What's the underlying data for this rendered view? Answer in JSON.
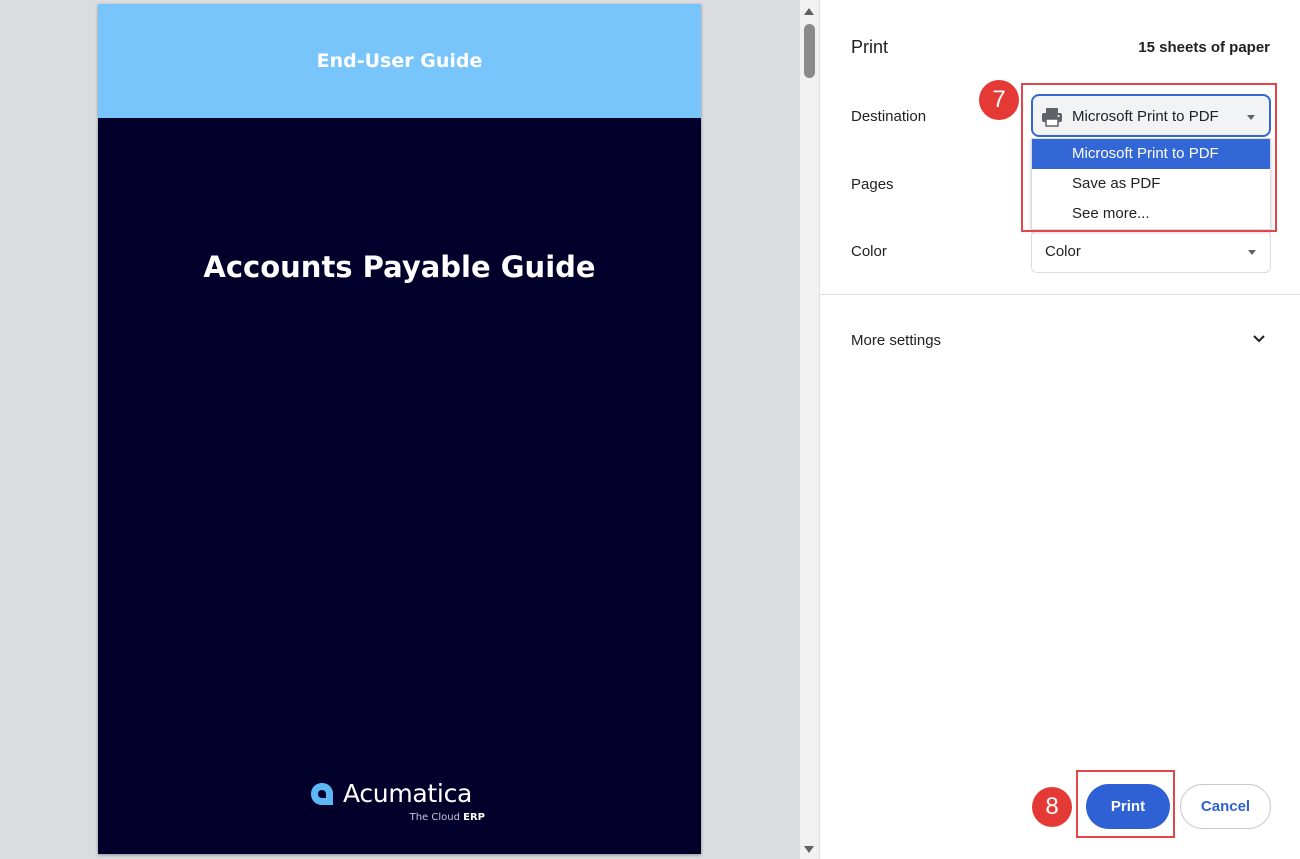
{
  "preview": {
    "header_text": "End-User Guide",
    "doc_title": "Accounts Payable Guide",
    "logo": {
      "name": "Acumatica",
      "tagline_prefix": "The Cloud",
      "tagline_bold": "ERP"
    }
  },
  "panel": {
    "title": "Print",
    "sheets": "15 sheets of paper",
    "destination": {
      "label": "Destination",
      "value": "Microsoft Print to PDF",
      "icon": "printer-icon",
      "options": [
        "Microsoft Print to PDF",
        "Save as PDF",
        "See more..."
      ],
      "selected_index": 0
    },
    "pages": {
      "label": "Pages"
    },
    "color": {
      "label": "Color",
      "value": "Color"
    },
    "more_settings": {
      "label": "More settings",
      "icon": "chevron-down-icon"
    },
    "buttons": {
      "print": "Print",
      "cancel": "Cancel"
    }
  },
  "annotations": {
    "step_destination": "7",
    "step_print": "8"
  },
  "colors": {
    "accent": "#3367d6",
    "print_button": "#2f61d4",
    "callout": "#e53935",
    "page_header": "#78c5fc",
    "page_bg": "#02002b"
  }
}
